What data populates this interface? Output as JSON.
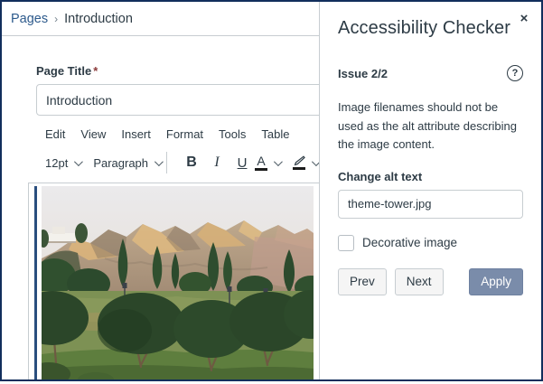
{
  "breadcrumb": {
    "pages_link": "Pages",
    "separator": "›",
    "current": "Introduction"
  },
  "form": {
    "page_title_label": "Page Title",
    "required_asterisk": "*",
    "page_title_value": "Introduction"
  },
  "editor": {
    "menus": [
      "Edit",
      "View",
      "Insert",
      "Format",
      "Tools",
      "Table"
    ],
    "toolbar": {
      "font_size": "12pt",
      "paragraph_style": "Paragraph",
      "bold_label": "B",
      "italic_label": "I",
      "underline_label": "U",
      "text_color_label": "A"
    }
  },
  "panel": {
    "title": "Accessibility Checker",
    "close_glyph": "×",
    "issue_counter": "Issue 2/2",
    "help_glyph": "?",
    "description": "Image filenames should not be used as the alt attribute describing the image content.",
    "alt_text_label": "Change alt text",
    "alt_text_value": "theme-tower.jpg",
    "decorative_label": "Decorative image",
    "decorative_checked": false,
    "prev_label": "Prev",
    "next_label": "Next",
    "apply_label": "Apply"
  },
  "colors": {
    "frame_border": "#122E5C",
    "text_dark": "#2D3B45",
    "link_blue": "#2D5A8C",
    "divider": "#C7CDD1",
    "apply_button_bg": "#7A8CAA",
    "selection_bar": "#2A4E7E",
    "secondary_button_bg": "#F5F5F5"
  }
}
